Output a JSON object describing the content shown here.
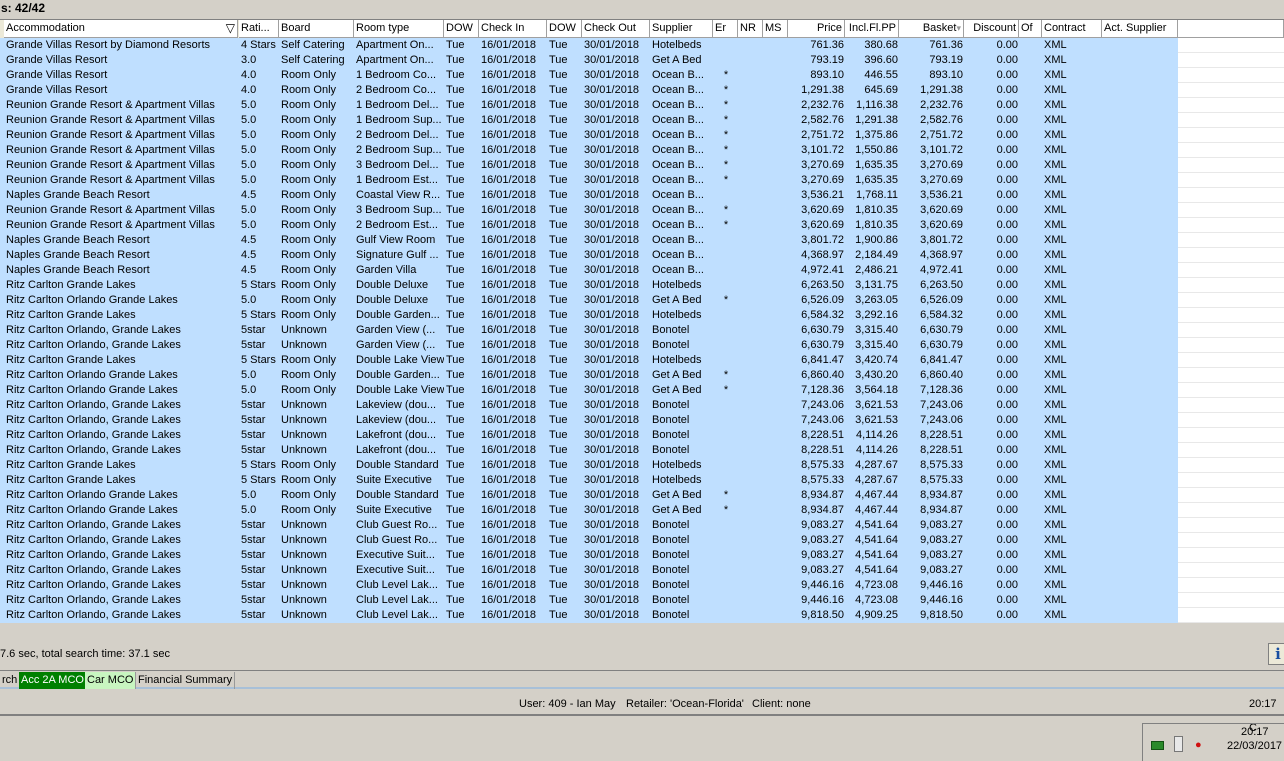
{
  "header": {
    "results_label": "s: 42/42"
  },
  "columns": [
    "Accommodation",
    "Rati...",
    "Board",
    "Room type",
    "DOW",
    "Check In",
    "DOW",
    "Check Out",
    "Supplier",
    "Er",
    "NR",
    "MS",
    "Price",
    "Incl.Fl.PP",
    "Basket",
    "Discount",
    "Of",
    "Contract",
    "Act. Supplier"
  ],
  "sort_column": "Basket",
  "filter_column": "Accommodation",
  "rows": [
    [
      "Grande Villas Resort by Diamond Resorts",
      "4 Stars",
      "Self Catering",
      "Apartment On...",
      "Tue",
      "16/01/2018",
      "Tue",
      "30/01/2018",
      "Hotelbeds",
      "",
      "",
      "",
      "761.36",
      "380.68",
      "761.36",
      "0.00",
      "",
      "XML",
      ""
    ],
    [
      "Grande Villas Resort",
      "3.0",
      "Self Catering",
      "Apartment On...",
      "Tue",
      "16/01/2018",
      "Tue",
      "30/01/2018",
      "Get A Bed",
      "",
      "",
      "",
      "793.19",
      "396.60",
      "793.19",
      "0.00",
      "",
      "XML",
      ""
    ],
    [
      "Grande Villas Resort",
      "4.0",
      "Room Only",
      "1 Bedroom Co...",
      "Tue",
      "16/01/2018",
      "Tue",
      "30/01/2018",
      "Ocean B...",
      "*",
      "",
      "",
      "893.10",
      "446.55",
      "893.10",
      "0.00",
      "",
      "XML",
      ""
    ],
    [
      "Grande Villas Resort",
      "4.0",
      "Room Only",
      "2 Bedroom Co...",
      "Tue",
      "16/01/2018",
      "Tue",
      "30/01/2018",
      "Ocean B...",
      "*",
      "",
      "",
      "1,291.38",
      "645.69",
      "1,291.38",
      "0.00",
      "",
      "XML",
      ""
    ],
    [
      "Reunion Grande Resort & Apartment Villas",
      "5.0",
      "Room Only",
      "1 Bedroom Del...",
      "Tue",
      "16/01/2018",
      "Tue",
      "30/01/2018",
      "Ocean B...",
      "*",
      "",
      "",
      "2,232.76",
      "1,116.38",
      "2,232.76",
      "0.00",
      "",
      "XML",
      ""
    ],
    [
      "Reunion Grande Resort & Apartment Villas",
      "5.0",
      "Room Only",
      "1 Bedroom Sup...",
      "Tue",
      "16/01/2018",
      "Tue",
      "30/01/2018",
      "Ocean B...",
      "*",
      "",
      "",
      "2,582.76",
      "1,291.38",
      "2,582.76",
      "0.00",
      "",
      "XML",
      ""
    ],
    [
      "Reunion Grande Resort & Apartment Villas",
      "5.0",
      "Room Only",
      "2 Bedroom Del...",
      "Tue",
      "16/01/2018",
      "Tue",
      "30/01/2018",
      "Ocean B...",
      "*",
      "",
      "",
      "2,751.72",
      "1,375.86",
      "2,751.72",
      "0.00",
      "",
      "XML",
      ""
    ],
    [
      "Reunion Grande Resort & Apartment Villas",
      "5.0",
      "Room Only",
      "2 Bedroom Sup...",
      "Tue",
      "16/01/2018",
      "Tue",
      "30/01/2018",
      "Ocean B...",
      "*",
      "",
      "",
      "3,101.72",
      "1,550.86",
      "3,101.72",
      "0.00",
      "",
      "XML",
      ""
    ],
    [
      "Reunion Grande Resort & Apartment Villas",
      "5.0",
      "Room Only",
      "3 Bedroom Del...",
      "Tue",
      "16/01/2018",
      "Tue",
      "30/01/2018",
      "Ocean B...",
      "*",
      "",
      "",
      "3,270.69",
      "1,635.35",
      "3,270.69",
      "0.00",
      "",
      "XML",
      ""
    ],
    [
      "Reunion Grande Resort & Apartment Villas",
      "5.0",
      "Room Only",
      "1 Bedroom Est...",
      "Tue",
      "16/01/2018",
      "Tue",
      "30/01/2018",
      "Ocean B...",
      "*",
      "",
      "",
      "3,270.69",
      "1,635.35",
      "3,270.69",
      "0.00",
      "",
      "XML",
      ""
    ],
    [
      "Naples Grande Beach Resort",
      "4.5",
      "Room Only",
      "Coastal View R...",
      "Tue",
      "16/01/2018",
      "Tue",
      "30/01/2018",
      "Ocean B...",
      "",
      "",
      "",
      "3,536.21",
      "1,768.11",
      "3,536.21",
      "0.00",
      "",
      "XML",
      ""
    ],
    [
      "Reunion Grande Resort & Apartment Villas",
      "5.0",
      "Room Only",
      "3 Bedroom Sup...",
      "Tue",
      "16/01/2018",
      "Tue",
      "30/01/2018",
      "Ocean B...",
      "*",
      "",
      "",
      "3,620.69",
      "1,810.35",
      "3,620.69",
      "0.00",
      "",
      "XML",
      ""
    ],
    [
      "Reunion Grande Resort & Apartment Villas",
      "5.0",
      "Room Only",
      "2 Bedroom Est...",
      "Tue",
      "16/01/2018",
      "Tue",
      "30/01/2018",
      "Ocean B...",
      "*",
      "",
      "",
      "3,620.69",
      "1,810.35",
      "3,620.69",
      "0.00",
      "",
      "XML",
      ""
    ],
    [
      "Naples Grande Beach Resort",
      "4.5",
      "Room Only",
      "Gulf View Room",
      "Tue",
      "16/01/2018",
      "Tue",
      "30/01/2018",
      "Ocean B...",
      "",
      "",
      "",
      "3,801.72",
      "1,900.86",
      "3,801.72",
      "0.00",
      "",
      "XML",
      ""
    ],
    [
      "Naples Grande Beach Resort",
      "4.5",
      "Room Only",
      "Signature Gulf ...",
      "Tue",
      "16/01/2018",
      "Tue",
      "30/01/2018",
      "Ocean B...",
      "",
      "",
      "",
      "4,368.97",
      "2,184.49",
      "4,368.97",
      "0.00",
      "",
      "XML",
      ""
    ],
    [
      "Naples Grande Beach Resort",
      "4.5",
      "Room Only",
      "Garden Villa",
      "Tue",
      "16/01/2018",
      "Tue",
      "30/01/2018",
      "Ocean B...",
      "",
      "",
      "",
      "4,972.41",
      "2,486.21",
      "4,972.41",
      "0.00",
      "",
      "XML",
      ""
    ],
    [
      "Ritz Carlton Grande Lakes",
      "5 Stars",
      "Room Only",
      "Double Deluxe",
      "Tue",
      "16/01/2018",
      "Tue",
      "30/01/2018",
      "Hotelbeds",
      "",
      "",
      "",
      "6,263.50",
      "3,131.75",
      "6,263.50",
      "0.00",
      "",
      "XML",
      ""
    ],
    [
      "Ritz Carlton Orlando Grande Lakes",
      "5.0",
      "Room Only",
      "Double Deluxe",
      "Tue",
      "16/01/2018",
      "Tue",
      "30/01/2018",
      "Get A Bed",
      "*",
      "",
      "",
      "6,526.09",
      "3,263.05",
      "6,526.09",
      "0.00",
      "",
      "XML",
      ""
    ],
    [
      "Ritz Carlton Grande Lakes",
      "5 Stars",
      "Room Only",
      "Double Garden...",
      "Tue",
      "16/01/2018",
      "Tue",
      "30/01/2018",
      "Hotelbeds",
      "",
      "",
      "",
      "6,584.32",
      "3,292.16",
      "6,584.32",
      "0.00",
      "",
      "XML",
      ""
    ],
    [
      "Ritz Carlton Orlando, Grande Lakes",
      "5star",
      "Unknown",
      "Garden View (...",
      "Tue",
      "16/01/2018",
      "Tue",
      "30/01/2018",
      "Bonotel",
      "",
      "",
      "",
      "6,630.79",
      "3,315.40",
      "6,630.79",
      "0.00",
      "",
      "XML",
      ""
    ],
    [
      "Ritz Carlton Orlando, Grande Lakes",
      "5star",
      "Unknown",
      "Garden View (...",
      "Tue",
      "16/01/2018",
      "Tue",
      "30/01/2018",
      "Bonotel",
      "",
      "",
      "",
      "6,630.79",
      "3,315.40",
      "6,630.79",
      "0.00",
      "",
      "XML",
      ""
    ],
    [
      "Ritz Carlton Grande Lakes",
      "5 Stars",
      "Room Only",
      "Double Lake View",
      "Tue",
      "16/01/2018",
      "Tue",
      "30/01/2018",
      "Hotelbeds",
      "",
      "",
      "",
      "6,841.47",
      "3,420.74",
      "6,841.47",
      "0.00",
      "",
      "XML",
      ""
    ],
    [
      "Ritz Carlton Orlando Grande Lakes",
      "5.0",
      "Room Only",
      "Double Garden...",
      "Tue",
      "16/01/2018",
      "Tue",
      "30/01/2018",
      "Get A Bed",
      "*",
      "",
      "",
      "6,860.40",
      "3,430.20",
      "6,860.40",
      "0.00",
      "",
      "XML",
      ""
    ],
    [
      "Ritz Carlton Orlando Grande Lakes",
      "5.0",
      "Room Only",
      "Double Lake View",
      "Tue",
      "16/01/2018",
      "Tue",
      "30/01/2018",
      "Get A Bed",
      "*",
      "",
      "",
      "7,128.36",
      "3,564.18",
      "7,128.36",
      "0.00",
      "",
      "XML",
      ""
    ],
    [
      "Ritz Carlton Orlando, Grande Lakes",
      "5star",
      "Unknown",
      "Lakeview (dou...",
      "Tue",
      "16/01/2018",
      "Tue",
      "30/01/2018",
      "Bonotel",
      "",
      "",
      "",
      "7,243.06",
      "3,621.53",
      "7,243.06",
      "0.00",
      "",
      "XML",
      ""
    ],
    [
      "Ritz Carlton Orlando, Grande Lakes",
      "5star",
      "Unknown",
      "Lakeview (dou...",
      "Tue",
      "16/01/2018",
      "Tue",
      "30/01/2018",
      "Bonotel",
      "",
      "",
      "",
      "7,243.06",
      "3,621.53",
      "7,243.06",
      "0.00",
      "",
      "XML",
      ""
    ],
    [
      "Ritz Carlton Orlando, Grande Lakes",
      "5star",
      "Unknown",
      "Lakefront (dou...",
      "Tue",
      "16/01/2018",
      "Tue",
      "30/01/2018",
      "Bonotel",
      "",
      "",
      "",
      "8,228.51",
      "4,114.26",
      "8,228.51",
      "0.00",
      "",
      "XML",
      ""
    ],
    [
      "Ritz Carlton Orlando, Grande Lakes",
      "5star",
      "Unknown",
      "Lakefront (dou...",
      "Tue",
      "16/01/2018",
      "Tue",
      "30/01/2018",
      "Bonotel",
      "",
      "",
      "",
      "8,228.51",
      "4,114.26",
      "8,228.51",
      "0.00",
      "",
      "XML",
      ""
    ],
    [
      "Ritz Carlton Grande Lakes",
      "5 Stars",
      "Room Only",
      "Double Standard",
      "Tue",
      "16/01/2018",
      "Tue",
      "30/01/2018",
      "Hotelbeds",
      "",
      "",
      "",
      "8,575.33",
      "4,287.67",
      "8,575.33",
      "0.00",
      "",
      "XML",
      ""
    ],
    [
      "Ritz Carlton Grande Lakes",
      "5 Stars",
      "Room Only",
      "Suite Executive",
      "Tue",
      "16/01/2018",
      "Tue",
      "30/01/2018",
      "Hotelbeds",
      "",
      "",
      "",
      "8,575.33",
      "4,287.67",
      "8,575.33",
      "0.00",
      "",
      "XML",
      ""
    ],
    [
      "Ritz Carlton Orlando Grande Lakes",
      "5.0",
      "Room Only",
      "Double Standard",
      "Tue",
      "16/01/2018",
      "Tue",
      "30/01/2018",
      "Get A Bed",
      "*",
      "",
      "",
      "8,934.87",
      "4,467.44",
      "8,934.87",
      "0.00",
      "",
      "XML",
      ""
    ],
    [
      "Ritz Carlton Orlando Grande Lakes",
      "5.0",
      "Room Only",
      "Suite Executive",
      "Tue",
      "16/01/2018",
      "Tue",
      "30/01/2018",
      "Get A Bed",
      "*",
      "",
      "",
      "8,934.87",
      "4,467.44",
      "8,934.87",
      "0.00",
      "",
      "XML",
      ""
    ],
    [
      "Ritz Carlton Orlando, Grande Lakes",
      "5star",
      "Unknown",
      "Club Guest Ro...",
      "Tue",
      "16/01/2018",
      "Tue",
      "30/01/2018",
      "Bonotel",
      "",
      "",
      "",
      "9,083.27",
      "4,541.64",
      "9,083.27",
      "0.00",
      "",
      "XML",
      ""
    ],
    [
      "Ritz Carlton Orlando, Grande Lakes",
      "5star",
      "Unknown",
      "Club Guest Ro...",
      "Tue",
      "16/01/2018",
      "Tue",
      "30/01/2018",
      "Bonotel",
      "",
      "",
      "",
      "9,083.27",
      "4,541.64",
      "9,083.27",
      "0.00",
      "",
      "XML",
      ""
    ],
    [
      "Ritz Carlton Orlando, Grande Lakes",
      "5star",
      "Unknown",
      "Executive Suit...",
      "Tue",
      "16/01/2018",
      "Tue",
      "30/01/2018",
      "Bonotel",
      "",
      "",
      "",
      "9,083.27",
      "4,541.64",
      "9,083.27",
      "0.00",
      "",
      "XML",
      ""
    ],
    [
      "Ritz Carlton Orlando, Grande Lakes",
      "5star",
      "Unknown",
      "Executive Suit...",
      "Tue",
      "16/01/2018",
      "Tue",
      "30/01/2018",
      "Bonotel",
      "",
      "",
      "",
      "9,083.27",
      "4,541.64",
      "9,083.27",
      "0.00",
      "",
      "XML",
      ""
    ],
    [
      "Ritz Carlton Orlando, Grande Lakes",
      "5star",
      "Unknown",
      "Club Level Lak...",
      "Tue",
      "16/01/2018",
      "Tue",
      "30/01/2018",
      "Bonotel",
      "",
      "",
      "",
      "9,446.16",
      "4,723.08",
      "9,446.16",
      "0.00",
      "",
      "XML",
      ""
    ],
    [
      "Ritz Carlton Orlando, Grande Lakes",
      "5star",
      "Unknown",
      "Club Level Lak...",
      "Tue",
      "16/01/2018",
      "Tue",
      "30/01/2018",
      "Bonotel",
      "",
      "",
      "",
      "9,446.16",
      "4,723.08",
      "9,446.16",
      "0.00",
      "",
      "XML",
      ""
    ],
    [
      "Ritz Carlton Orlando, Grande Lakes",
      "5star",
      "Unknown",
      "Club Level Lak...",
      "Tue",
      "16/01/2018",
      "Tue",
      "30/01/2018",
      "Bonotel",
      "",
      "",
      "",
      "9,818.50",
      "4,909.25",
      "9,818.50",
      "0.00",
      "",
      "XML",
      ""
    ]
  ],
  "status": {
    "search_time": "7.6 sec, total search time: 37.1 sec",
    "info_button": "i"
  },
  "tabs": [
    {
      "label": "rch"
    },
    {
      "label": "Acc 2A MCO",
      "color": "#008000"
    },
    {
      "label": "Car MCO",
      "color": "#c8f5c0"
    },
    {
      "label": "Financial Summary"
    }
  ],
  "statusbar": {
    "user": "User: 409 - Ian May",
    "retailer": "Retailer: 'Ocean-Florida'",
    "client": "Client: none",
    "time": "20:17 C"
  },
  "taskbar": {
    "time": "20:17",
    "date": "22/03/2017",
    "tray_icons": [
      "network-icon",
      "usb-device-icon",
      "speaker-muted-icon"
    ]
  },
  "colors": {
    "row_bg": "#bfdfff",
    "window_bg": "#d4d0c8"
  }
}
